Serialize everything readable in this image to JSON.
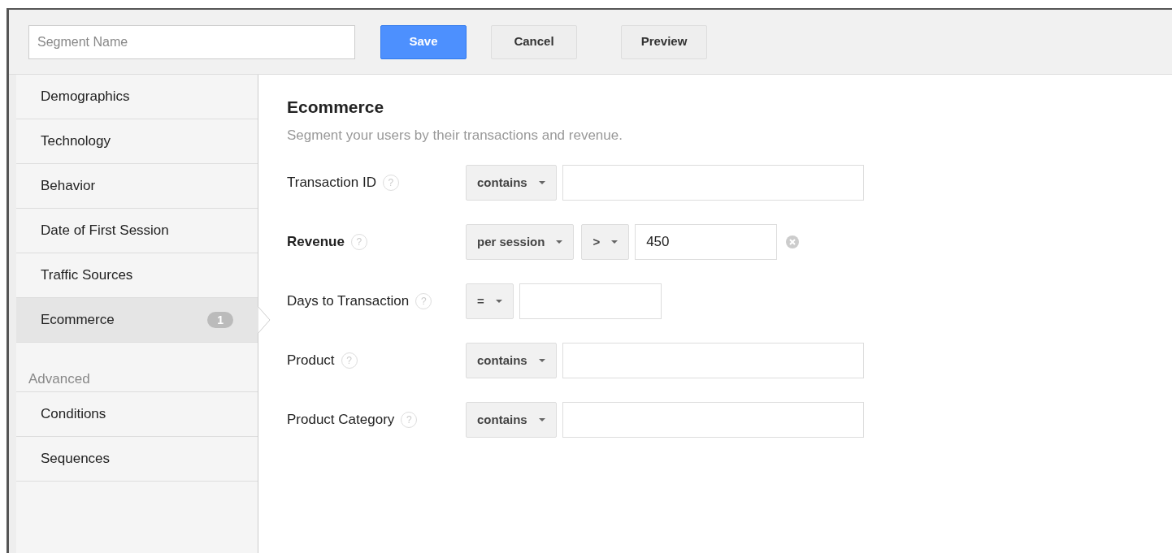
{
  "toolbar": {
    "segment_name": {
      "placeholder": "Segment Name"
    },
    "buttons": [
      {
        "label": "Save",
        "kind": "primary"
      },
      {
        "label": "Cancel",
        "kind": "default"
      },
      {
        "label": "Preview",
        "kind": "default"
      }
    ]
  },
  "sidebar": {
    "items": [
      {
        "label": "Demographics",
        "selected": false
      },
      {
        "label": "Technology",
        "selected": false
      },
      {
        "label": "Behavior",
        "selected": false
      },
      {
        "label": "Date of First Session",
        "selected": false
      },
      {
        "label": "Traffic Sources",
        "selected": false
      },
      {
        "label": "Ecommerce",
        "selected": true,
        "badge": "1"
      }
    ],
    "advanced": {
      "heading": "Advanced",
      "items": [
        {
          "label": "Conditions",
          "selected": false
        },
        {
          "label": "Sequences",
          "selected": false
        }
      ]
    }
  },
  "panel": {
    "title": "Ecommerce",
    "subtitle": "Segment your users by their transactions and revenue.",
    "filters": [
      {
        "label": "Transaction ID",
        "help": "?",
        "active": false,
        "dropdowns": [
          "contains"
        ],
        "field": {
          "kind": "wide"
        }
      },
      {
        "label": "Revenue",
        "help": "?",
        "active": true,
        "dropdowns": [
          "per session",
          ">"
        ],
        "field": {
          "kind": "narrow",
          "value": "450"
        }
      },
      {
        "label": "Days to Transaction",
        "help": "?",
        "active": false,
        "dropdowns": [
          "="
        ],
        "field": {
          "kind": "narrow"
        }
      },
      {
        "label": "Product",
        "help": "?",
        "active": false,
        "dropdowns": [
          "contains"
        ],
        "field": {
          "kind": "wide"
        }
      },
      {
        "label": "Product Category",
        "help": "?",
        "active": false,
        "dropdowns": [
          "contains"
        ],
        "field": {
          "kind": "wide"
        }
      }
    ]
  }
}
